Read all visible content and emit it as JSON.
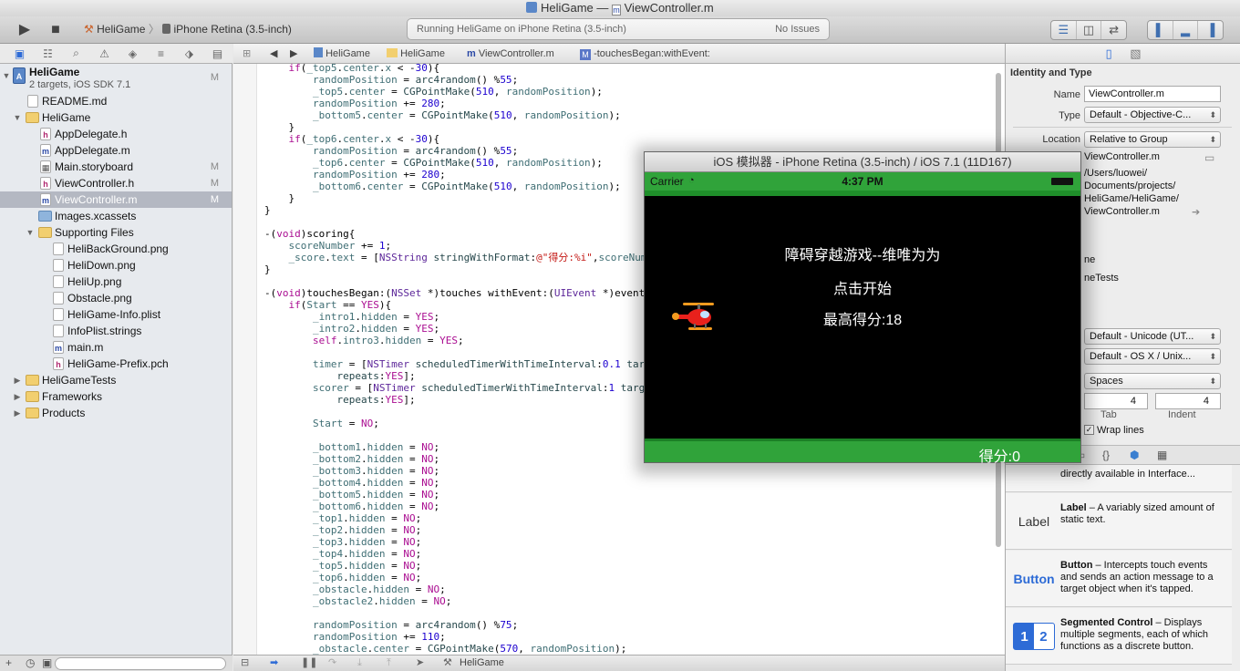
{
  "window": {
    "title_project": "HeliGame",
    "title_sep": "—",
    "title_file": "ViewController.m"
  },
  "toolbar": {
    "scheme": "HeliGame",
    "device": "iPhone Retina (3.5-inch)",
    "activity": "Running HeliGame on iPhone Retina (3.5-inch)",
    "issues": "No Issues"
  },
  "navigator": {
    "rows": [
      {
        "label": "HeliGame",
        "sub": "2 targets, iOS SDK 7.1",
        "status": "M"
      },
      {
        "label": "README.md",
        "status": ""
      },
      {
        "label": "HeliGame",
        "status": ""
      },
      {
        "label": "AppDelegate.h",
        "status": ""
      },
      {
        "label": "AppDelegate.m",
        "status": ""
      },
      {
        "label": "Main.storyboard",
        "status": "M"
      },
      {
        "label": "ViewController.h",
        "status": "M"
      },
      {
        "label": "ViewController.m",
        "status": "M"
      },
      {
        "label": "Images.xcassets",
        "status": ""
      },
      {
        "label": "Supporting Files",
        "status": ""
      },
      {
        "label": "HeliBackGround.png",
        "status": ""
      },
      {
        "label": "HeliDown.png",
        "status": ""
      },
      {
        "label": "HeliUp.png",
        "status": ""
      },
      {
        "label": "Obstacle.png",
        "status": ""
      },
      {
        "label": "HeliGame-Info.plist",
        "status": ""
      },
      {
        "label": "InfoPlist.strings",
        "status": ""
      },
      {
        "label": "main.m",
        "status": ""
      },
      {
        "label": "HeliGame-Prefix.pch",
        "status": ""
      },
      {
        "label": "HeliGameTests",
        "status": ""
      },
      {
        "label": "Frameworks",
        "status": ""
      },
      {
        "label": "Products",
        "status": ""
      }
    ]
  },
  "jumpbar": {
    "crumbs": [
      "HeliGame",
      "HeliGame",
      "ViewController.m",
      "-touchesBegan:withEvent:"
    ]
  },
  "debug": {
    "target": "HeliGame"
  },
  "inspector": {
    "section_identity": "Identity and Type",
    "name_label": "Name",
    "name_value": "ViewController.m",
    "type_label": "Type",
    "type_value": "Default - Objective-C...",
    "location_label": "Location",
    "location_value": "Relative to Group",
    "path_lines": [
      "ViewController.m",
      "/Users/luowei/",
      "Documents/projects/",
      "HeliGame/HeliGame/",
      "ViewController.m"
    ],
    "membership_head": "ship",
    "membership_items": [
      "ne",
      "neTests"
    ],
    "encoding_value": "Default - Unicode (UT...",
    "line_endings_value": "Default - OS X / Unix...",
    "indent_using_value": "Spaces",
    "tab_value": "4",
    "indent_value": "4",
    "tab_label": "Tab",
    "indent_label": "Indent",
    "wrap_label": "Wrap lines"
  },
  "library": {
    "items": [
      {
        "title": "",
        "desc": "directly available in Interface..."
      },
      {
        "icon_text": "Label",
        "title": "Label",
        "desc": " – A variably sized amount of static text."
      },
      {
        "icon_text": "Button",
        "title": "Button",
        "desc": " – Intercepts touch events and sends an action message to a target object when it's tapped."
      },
      {
        "icon_text": "1 2",
        "title": "Segmented Control",
        "desc": " – Displays multiple segments, each of which functions as a discrete button."
      }
    ]
  },
  "simulator": {
    "title": "iOS 模拟器 - iPhone Retina (3.5-inch) / iOS 7.1 (11D167)",
    "carrier": "Carrier",
    "time": "4:37 PM",
    "game_title": "障碍穿越游戏--维唯为为",
    "start_text": "点击开始",
    "high_score": "最高得分:18",
    "score": "得分:0"
  },
  "colors": {
    "game_green": "#30a33a",
    "selection": "#b4b8c2",
    "accent": "#2d6bd6"
  }
}
